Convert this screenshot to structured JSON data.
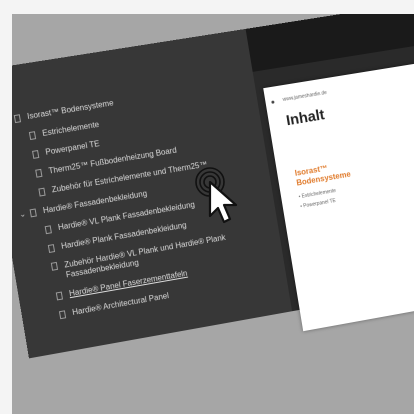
{
  "bookmarks": [
    {
      "label": "Isorast™ Bodensysteme",
      "level": 0,
      "expanded": true
    },
    {
      "label": "Estrichelemente",
      "level": 1
    },
    {
      "label": "Powerpanel TE",
      "level": 1
    },
    {
      "label": "Therm25™ Fußbodenheizung Board",
      "level": 1
    },
    {
      "label": "Zubehör für Estrichelemente und Therm25™",
      "level": 1
    },
    {
      "label": "Hardie® Fassadenbekleidung",
      "level": 0,
      "expanded": true
    },
    {
      "label": "Hardie® VL Plank Fassadenbekleidung",
      "level": 1
    },
    {
      "label": "Hardie® Plank Fassadenbekleidung",
      "level": 1
    },
    {
      "label": "Zubehör Hardie® VL Plank und Hardie® Plank Fassadenbekleidung",
      "level": 1
    },
    {
      "label": "Hardie® Panel Faserzementtafeln",
      "level": 1,
      "underlined": true
    },
    {
      "label": "Hardie® Architectural Panel",
      "level": 1
    }
  ],
  "document": {
    "url": "www.jameshardie.de",
    "heading": "Inhalt",
    "section_title": "Isorast™ Bodensysteme",
    "lines": [
      "• Estrichelemente",
      "• Powerpanel TE"
    ]
  },
  "icons": {
    "cursor": "arrow-pointer-icon",
    "click": "click-ripple-icon"
  }
}
